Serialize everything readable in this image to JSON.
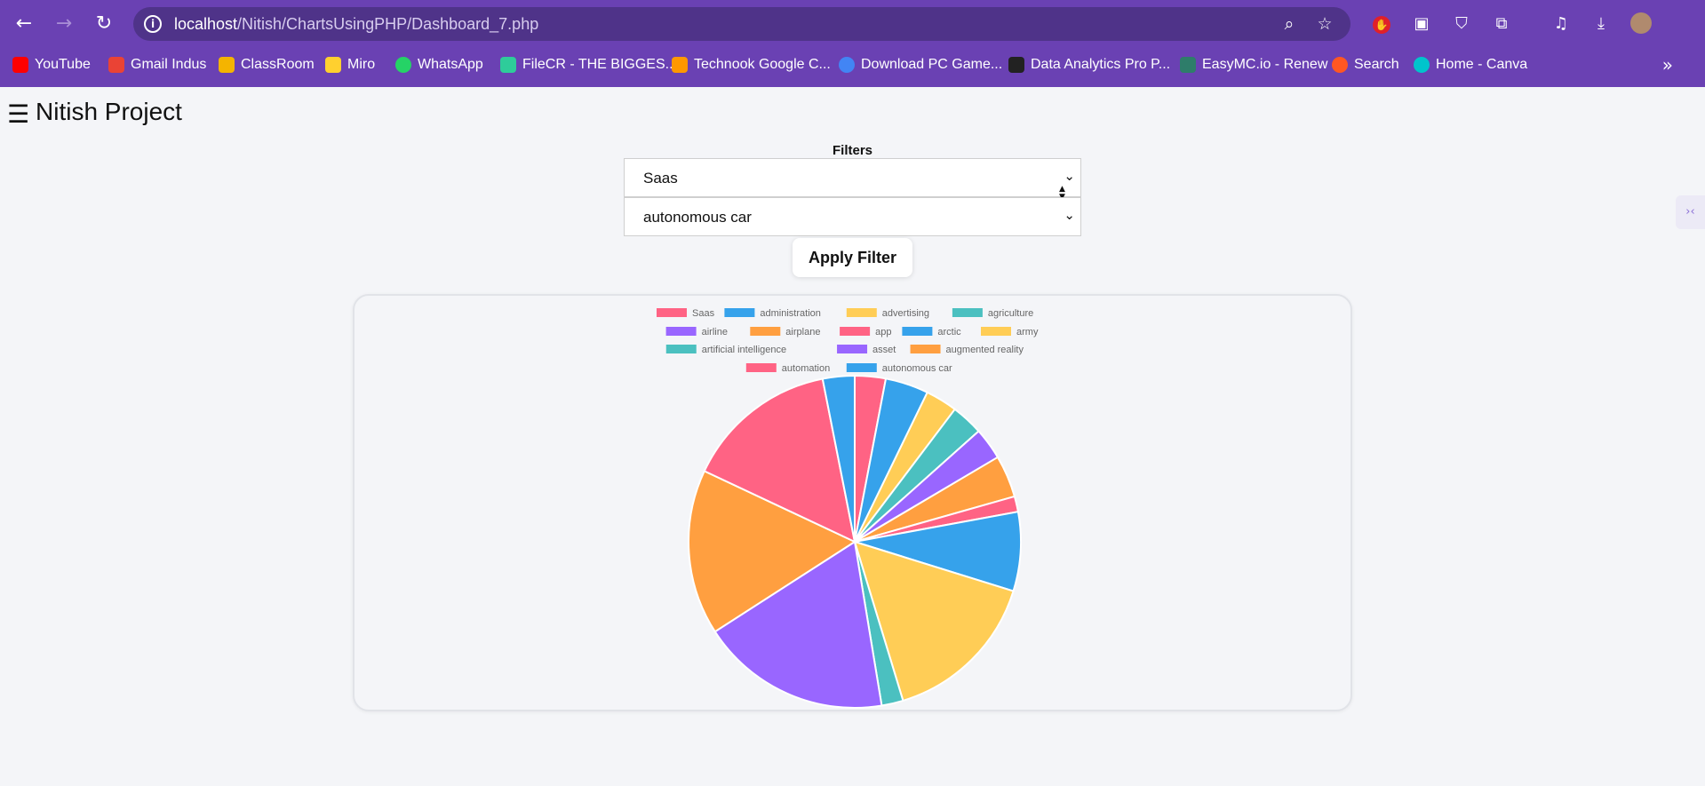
{
  "browser": {
    "url_host": "localhost",
    "url_path": "/Nitish/ChartsUsingPHP/Dashboard_7.php",
    "bookmarks": [
      {
        "label": "YouTube",
        "color": "#ff0000"
      },
      {
        "label": "Gmail Indus",
        "color": "#ea4335"
      },
      {
        "label": "ClassRoom",
        "color": "#f4b400"
      },
      {
        "label": "Miro",
        "color": "#ffd02f"
      },
      {
        "label": "WhatsApp",
        "color": "#25d366"
      },
      {
        "label": "FileCR - THE BIGGES...",
        "color": "#2ecc9a"
      },
      {
        "label": "Technook Google C...",
        "color": "#ff9800"
      },
      {
        "label": "Download PC Game...",
        "color": "#4285f4"
      },
      {
        "label": "Data Analytics Pro P...",
        "color": "#222222"
      },
      {
        "label": "EasyMC.io - Renew",
        "color": "#2e7d6a"
      },
      {
        "label": "Search",
        "color": "#ff5722"
      },
      {
        "label": "Home - Canva",
        "color": "#00c4cc"
      }
    ]
  },
  "app": {
    "menu_icon": "☰",
    "title": "Nitish Project"
  },
  "filters": {
    "label": "Filters",
    "select1_value": "Saas",
    "select2_value": "autonomous car",
    "apply_label": "Apply Filter"
  },
  "chart_data": {
    "type": "pie",
    "legend_position": "top",
    "palette": [
      "#ff6384",
      "#36a2eb",
      "#ffcd56",
      "#4bc0c0",
      "#9966ff",
      "#ff9f40"
    ],
    "legend": [
      "Saas",
      "administration",
      "advertising",
      "agriculture",
      "airline",
      "airplane",
      "app",
      "arctic",
      "army",
      "artificial intelligence",
      "asset",
      "augmented reality",
      "automation",
      "autonomous car"
    ],
    "slices": [
      {
        "label": "Saas",
        "value": 3.0
      },
      {
        "label": "administration",
        "value": 4.2
      },
      {
        "label": "advertising",
        "value": 3.1
      },
      {
        "label": "agriculture",
        "value": 3.1
      },
      {
        "label": "airline",
        "value": 3.1
      },
      {
        "label": "airplane",
        "value": 4.1
      },
      {
        "label": "app",
        "value": 1.5
      },
      {
        "label": "arctic",
        "value": 7.7
      },
      {
        "label": "army",
        "value": 15.5
      },
      {
        "label": "artificial intelligence",
        "value": 2.1
      },
      {
        "label": "asset",
        "value": 18.5
      },
      {
        "label": "augmented reality",
        "value": 16.1
      },
      {
        "label": "automation",
        "value": 14.9
      },
      {
        "label": "autonomous car",
        "value": 3.1
      }
    ]
  }
}
